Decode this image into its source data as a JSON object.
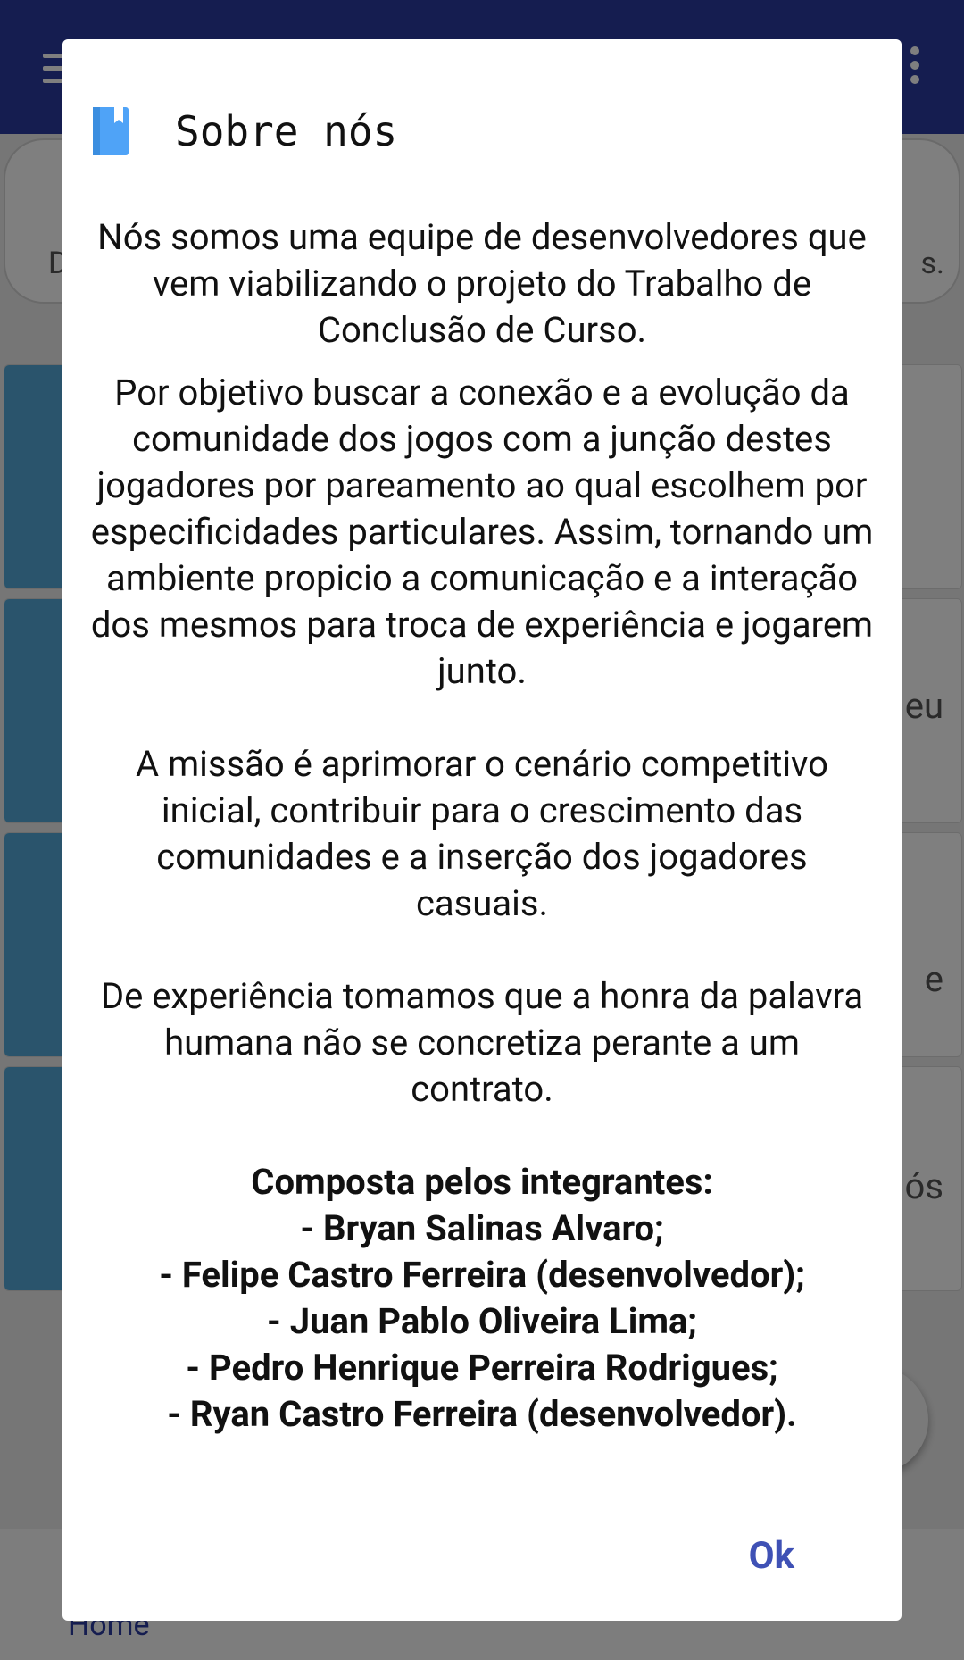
{
  "background": {
    "card_tails": [
      "eu",
      "e",
      "ós"
    ],
    "header_card_left": "D",
    "header_card_right": "s.",
    "bottom_nav_label": "Home"
  },
  "dialog": {
    "icon": "book-icon",
    "title": "Sobre nós",
    "paragraphs": {
      "intro": "Nós somos uma equipe de desenvolvedores que vem viabilizando o projeto do Trabalho de Conclusão de Curso.",
      "objective": "Por objetivo buscar a conexão e a evolução da comunidade dos jogos com a junção destes jogadores por pareamento ao  qual escolhem por especificidades particulares. Assim, tornando um ambiente propicio a comunicação e a interação dos mesmos para troca de experiência e jogarem junto.",
      "mission": "A missão é aprimorar o cenário competitivo inicial, contribuir para o crescimento das comunidades e a inserção dos jogadores casuais.",
      "experience": "De experiência tomamos que a honra da palavra humana não se concretiza perante a um contrato."
    },
    "members_heading": "Composta pelos integrantes:",
    "members": [
      "- Bryan Salinas Alvaro;",
      "- Felipe Castro Ferreira (desenvolvedor);",
      "- Juan Pablo Oliveira Lima;",
      "- Pedro Henrique Perreira Rodrigues;",
      "- Ryan Castro Ferreira (desenvolvedor)."
    ],
    "ok_label": "Ok"
  },
  "colors": {
    "appbar": "#2b3aa0",
    "accent": "#3f51b5",
    "card_stripe": "#54a9d8",
    "icon_blue": "#4fa3f7"
  }
}
